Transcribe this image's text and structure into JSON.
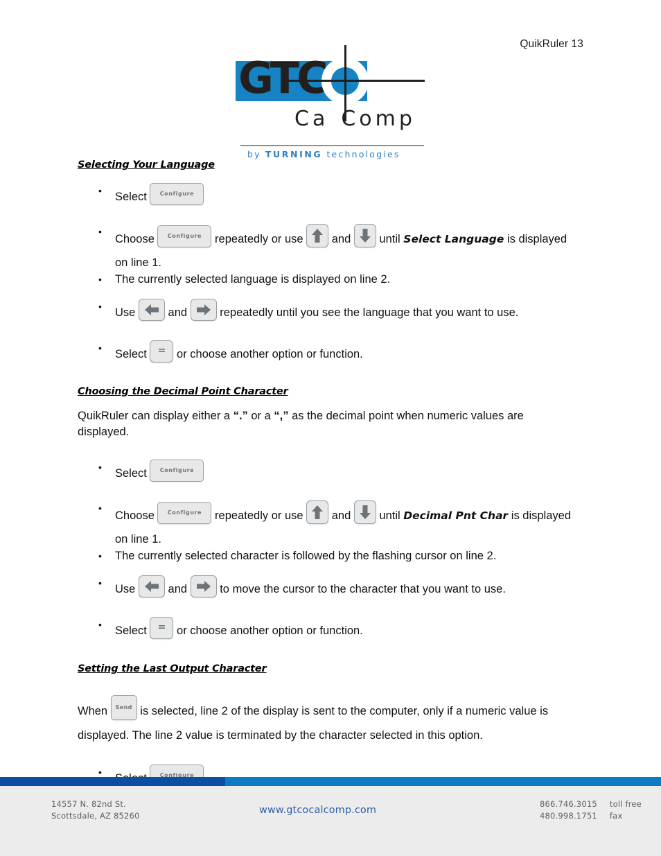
{
  "header": {
    "running_head": "QuikRuler 13"
  },
  "logo": {
    "wordmark": "GTC",
    "brand_second_line": "Ca Comp",
    "brand_second_line_left": "Ca",
    "brand_second_line_right": "Comp",
    "tagline_by": "by",
    "tagline_brand": "TURNING",
    "tagline_suffix": "technologies",
    "colors": {
      "blue_box": "#1683c4",
      "dark": "#221f1f",
      "tagline_blue": "#2f80c2"
    }
  },
  "sections": [
    {
      "heading": "Selecting Your Language",
      "bullets": [
        {
          "parts": [
            {
              "type": "text",
              "value": "Select "
            },
            {
              "type": "key",
              "key": "configure",
              "label": "Configure"
            }
          ]
        },
        {
          "parts": [
            {
              "type": "text",
              "value": "Choose "
            },
            {
              "type": "key",
              "key": "configure",
              "label": "Configure"
            },
            {
              "type": "text",
              "value": " repeatedly or use "
            },
            {
              "type": "key",
              "key": "arrow-up"
            },
            {
              "type": "text",
              "value": " and "
            },
            {
              "type": "key",
              "key": "arrow-down"
            },
            {
              "type": "text",
              "value": " until "
            },
            {
              "type": "strong",
              "value": "Select Language"
            },
            {
              "type": "text",
              "value": " is displayed on line 1."
            }
          ]
        },
        {
          "parts": [
            {
              "type": "text",
              "value": "The currently selected language is displayed on line 2."
            }
          ]
        },
        {
          "parts": [
            {
              "type": "text",
              "value": "Use "
            },
            {
              "type": "key",
              "key": "arrow-left"
            },
            {
              "type": "text",
              "value": " and "
            },
            {
              "type": "key",
              "key": "arrow-right"
            },
            {
              "type": "text",
              "value": " repeatedly until you see the language that you want to use."
            }
          ]
        },
        {
          "parts": [
            {
              "type": "text",
              "value": "Select "
            },
            {
              "type": "key",
              "key": "equals",
              "label": "="
            },
            {
              "type": "text",
              "value": " or choose another option or function."
            }
          ]
        }
      ]
    },
    {
      "heading": "Choosing the Decimal Point Character",
      "paragraph_parts": [
        {
          "type": "text",
          "value": "QuikRuler can display either a "
        },
        {
          "type": "quote",
          "value": "“.”"
        },
        {
          "type": "text",
          "value": " or a "
        },
        {
          "type": "quote",
          "value": "“,”"
        },
        {
          "type": "text",
          "value": " as the decimal point when numeric values are displayed."
        }
      ],
      "bullets": [
        {
          "parts": [
            {
              "type": "text",
              "value": "Select "
            },
            {
              "type": "key",
              "key": "configure",
              "label": "Configure"
            }
          ]
        },
        {
          "parts": [
            {
              "type": "text",
              "value": "Choose "
            },
            {
              "type": "key",
              "key": "configure",
              "label": "Configure"
            },
            {
              "type": "text",
              "value": " repeatedly or use "
            },
            {
              "type": "key",
              "key": "arrow-up"
            },
            {
              "type": "text",
              "value": " and "
            },
            {
              "type": "key",
              "key": "arrow-down"
            },
            {
              "type": "text",
              "value": " until "
            },
            {
              "type": "strong",
              "value": "Decimal Pnt Char"
            },
            {
              "type": "text",
              "value": " is displayed on line 1."
            }
          ]
        },
        {
          "parts": [
            {
              "type": "text",
              "value": "The currently selected character is followed by the flashing cursor on line 2."
            }
          ]
        },
        {
          "parts": [
            {
              "type": "text",
              "value": "Use "
            },
            {
              "type": "key",
              "key": "arrow-left"
            },
            {
              "type": "text",
              "value": " and "
            },
            {
              "type": "key",
              "key": "arrow-right"
            },
            {
              "type": "text",
              "value": " to move the cursor to the character that you want to use."
            }
          ]
        },
        {
          "parts": [
            {
              "type": "text",
              "value": "Select "
            },
            {
              "type": "key",
              "key": "equals",
              "label": "="
            },
            {
              "type": "text",
              "value": " or choose another option or function."
            }
          ]
        }
      ]
    },
    {
      "heading": "Setting the Last Output Character",
      "paragraph_parts": [
        {
          "type": "text",
          "value": "When "
        },
        {
          "type": "key",
          "key": "send",
          "label": "Send"
        },
        {
          "type": "text",
          "value": " is selected, line 2 of the display is sent to the computer, only if a numeric value is displayed.  The line 2 value is terminated by the character selected in this option."
        }
      ],
      "bullets": [
        {
          "parts": [
            {
              "type": "text",
              "value": "Select "
            },
            {
              "type": "key",
              "key": "configure",
              "label": "Configure"
            }
          ]
        }
      ]
    }
  ],
  "keys": {
    "configure": "Configure",
    "send": "Send",
    "equals": "=",
    "arrow_up": "arrow-up-icon",
    "arrow_down": "arrow-down-icon",
    "arrow_left": "arrow-left-icon",
    "arrow_right": "arrow-right-icon"
  },
  "footer": {
    "address_line1": "14557 N. 82nd St.",
    "address_line2": "Scottsdale, AZ 85260",
    "website": "www.gtcocalcomp.com",
    "phone_toll_free": "866.746.3015",
    "phone_toll_free_label": "toll free",
    "phone_fax": "480.998.1751",
    "phone_fax_label": "fax",
    "bar_dark_color": "#0b4ea2",
    "bar_light_color": "#0c7bc4"
  }
}
